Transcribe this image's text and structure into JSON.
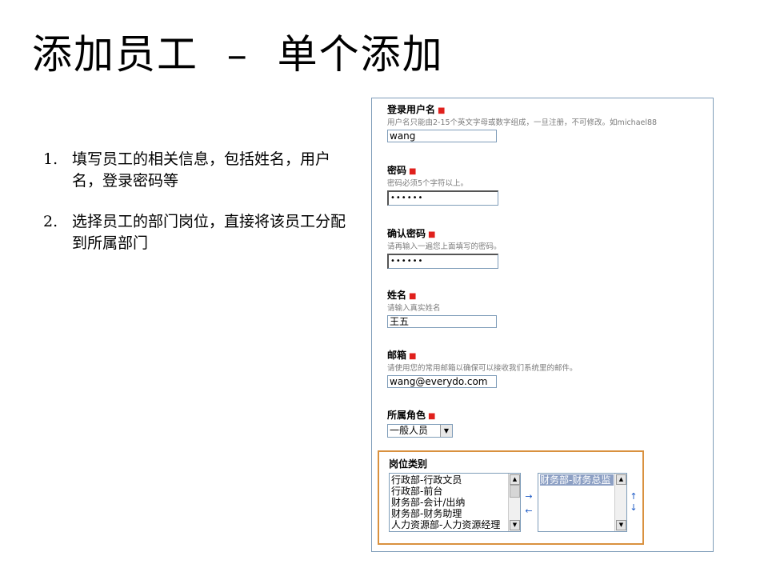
{
  "slide": {
    "title": "添加员工  –  单个添加",
    "bullets": [
      {
        "num": "1.",
        "text": "填写员工的相关信息，包括姓名，用户名，登录密码等"
      },
      {
        "num": "2.",
        "text": "选择员工的部门岗位，直接将该员工分配到所属部门"
      }
    ]
  },
  "form": {
    "required_mark": "■",
    "login_username": {
      "label": "登录用户名",
      "hint": "用户名只能由2-15个英文字母或数字组成，一旦注册，不可修改。如michael88",
      "value": "wang"
    },
    "password": {
      "label": "密码",
      "hint": "密码必须5个字符以上。",
      "value": "••••••"
    },
    "confirm_password": {
      "label": "确认密码",
      "hint": "请再输入一遍您上面填写的密码。",
      "value": "••••••"
    },
    "name": {
      "label": "姓名",
      "hint": "请输入真实姓名",
      "value": "王五"
    },
    "email": {
      "label": "邮箱",
      "hint": "请使用您的常用邮箱以确保可以接收我们系统里的邮件。",
      "value": "wang@everydo.com"
    },
    "role": {
      "label": "所属角色",
      "selected": "一般人员"
    },
    "positions": {
      "label": "岗位类别",
      "available": [
        "行政部-行政文员",
        "行政部-前台",
        "财务部-会计/出纳",
        "财务部-财务助理",
        "人力资源部-人力资源经理"
      ],
      "selected": [
        "财务部-财务总监"
      ],
      "add_arrow": "→",
      "remove_arrow": "←",
      "up_arrow": "↑",
      "down_arrow": "↓"
    }
  }
}
